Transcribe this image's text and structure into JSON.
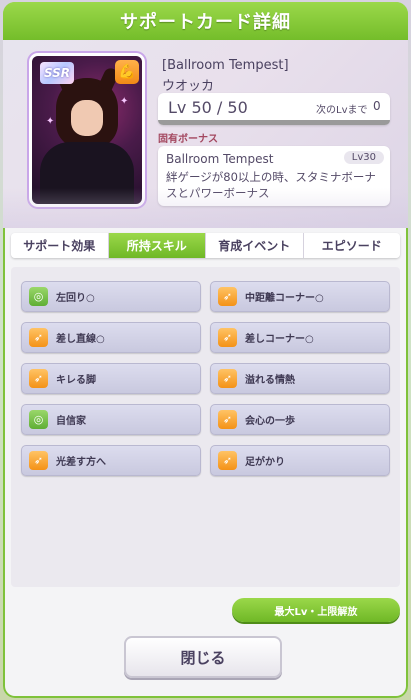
{
  "dialog": {
    "title": "サポートカード詳細"
  },
  "card": {
    "rarity": "SSR",
    "type_icon": "power-icon",
    "name": "[Ballroom Tempest]",
    "character": "ウオッカ",
    "level_text": "Lv 50 / 50",
    "next_level_label": "次のLvまで",
    "next_level_value": "0",
    "level_progress": 1.0
  },
  "bonus": {
    "section_label": "固有ボーナス",
    "title": "Ballroom Tempest",
    "level": "Lv30",
    "description": "絆ゲージが80以上の時、スタミナボーナスとパワーボーナス"
  },
  "tabs": [
    {
      "label": "サポート効果",
      "active": false
    },
    {
      "label": "所持スキル",
      "active": true
    },
    {
      "label": "育成イベント",
      "active": false
    },
    {
      "label": "エピソード",
      "active": false
    }
  ],
  "skills": [
    {
      "label": "左回り○",
      "color": "green"
    },
    {
      "label": "中距離コーナー○",
      "color": "orange"
    },
    {
      "label": "差し直線○",
      "color": "orange"
    },
    {
      "label": "差しコーナー○",
      "color": "orange"
    },
    {
      "label": "キレる脚",
      "color": "orange"
    },
    {
      "label": "溢れる情熱",
      "color": "orange"
    },
    {
      "label": "自信家",
      "color": "green"
    },
    {
      "label": "会心の一歩",
      "color": "orange"
    },
    {
      "label": "光差す方へ",
      "color": "orange"
    },
    {
      "label": "足がかり",
      "color": "orange"
    }
  ],
  "buttons": {
    "limit_break": "最大Lv・上限解放",
    "close": "閉じる"
  },
  "colors": {
    "accent_green": "#74bd2a",
    "skill_green": "#5fae35",
    "skill_orange": "#f49217",
    "bonus_label": "#a3475f"
  }
}
